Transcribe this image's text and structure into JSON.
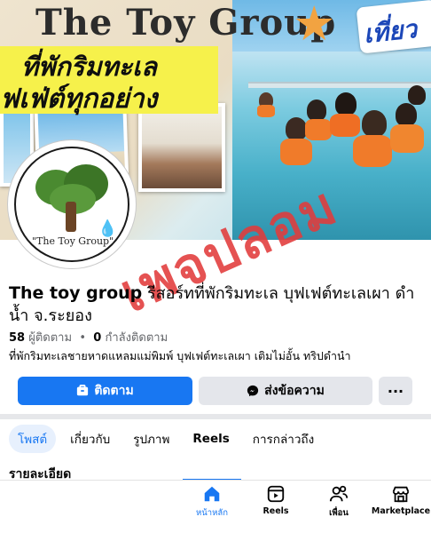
{
  "cover": {
    "title": "The Toy Group",
    "corner_tag": "เที่ยว",
    "tagline_line1": "ที่พักริมทะเล",
    "tagline_line2": "ฟเฟ่ต์ทุกอย่าง"
  },
  "avatar": {
    "caption": "\"The Toy Group\""
  },
  "watermark": "เพจปลอม",
  "page": {
    "name_bold": "The toy group",
    "name_rest": " รีสอร์ทที่พักริมทะเล บุฟเฟต์ทะเลเผา ดำน้ำ จ.ระยอง",
    "followers_count": "58",
    "followers_label": "ผู้ติดตาม",
    "following_count": "0",
    "following_label": "กำลังติดตาม",
    "bio": "ที่พักริมทะเลชายหาดแหลมแม่พิมพ์ บุฟเฟต์ทะเลเผา เติมไม่อั้น ทริปดำนำ"
  },
  "actions": {
    "follow": "ติดตาม",
    "message": "ส่งข้อความ",
    "more": "···"
  },
  "tabs": [
    {
      "label": "โพสต์",
      "active": true
    },
    {
      "label": "เกี่ยวกับ"
    },
    {
      "label": "รูปภาพ"
    },
    {
      "label": "Reels"
    },
    {
      "label": "การกล่าวถึง"
    }
  ],
  "section": {
    "title": "รายละเอียด"
  },
  "bottom_nav": [
    {
      "label": "หน้าหลัก",
      "icon": "home-icon",
      "active": true
    },
    {
      "label": "Reels",
      "icon": "reels-icon"
    },
    {
      "label": "เพื่อน",
      "icon": "friends-icon"
    },
    {
      "label": "Marketplace",
      "icon": "marketplace-icon"
    }
  ],
  "colors": {
    "accent": "#1877f2",
    "watermark": "#e23b3b",
    "button_grey": "#e4e6eb"
  }
}
